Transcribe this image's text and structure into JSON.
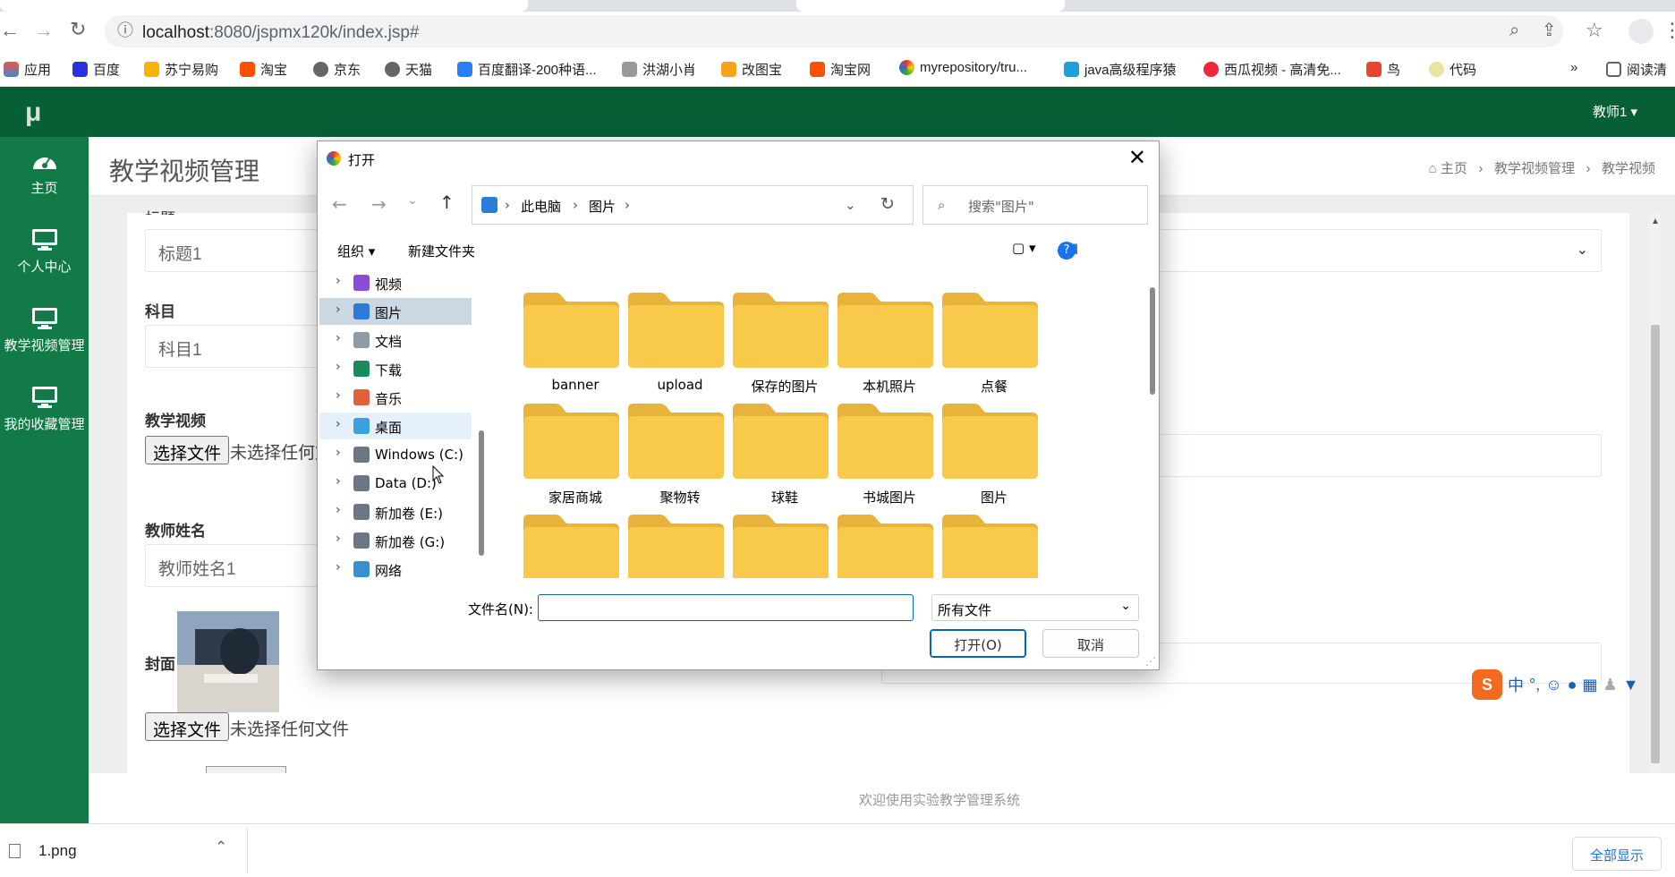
{
  "browser": {
    "url_host": "localhost",
    "url_rest": ":8080/jspmx120k/index.jsp#",
    "bookmarks": [
      "应用",
      "百度",
      "苏宁易购",
      "淘宝",
      "京东",
      "天猫",
      "百度翻译-200种语...",
      "洪湖小肖",
      "改图宝",
      "淘宝网",
      "myrepository/tru...",
      "java高级程序猿",
      "西瓜视频 - 高清免...",
      "鸟",
      "代码"
    ],
    "bookmarks_more": "»",
    "reading_list": "阅读清"
  },
  "app": {
    "logo": "μ",
    "user_menu": "教师1 ▾",
    "sidebar": [
      {
        "label": "主页",
        "icon": "dashboard-icon"
      },
      {
        "label": "个人中心",
        "icon": "monitor-icon"
      },
      {
        "label": "教学视频管理",
        "icon": "monitor-icon"
      },
      {
        "label": "我的收藏管理",
        "icon": "monitor-icon"
      }
    ],
    "page_title": "教学视频管理",
    "breadcrumb": {
      "home": "主页",
      "sep": "›",
      "level1": "教学视频管理",
      "level2": "教学视频"
    },
    "form": {
      "title_partial": "标题",
      "title_value": "标题1",
      "subject_label": "科目",
      "subject_value": "科目1",
      "video_label": "教学视频",
      "choose_file": "选择文件",
      "no_file": "未选择任何文件",
      "no_file_partial": "未选择任何文",
      "teacher_label": "教师姓名",
      "teacher_value": "教师姓名1",
      "cover_label": "封面"
    },
    "footer": "欢迎使用实验教学管理系统"
  },
  "dialog": {
    "title": "打开",
    "close": "✕",
    "path": [
      "此电脑",
      "图片"
    ],
    "search_placeholder": "搜索\"图片\"",
    "organize": "组织 ▾",
    "new_folder": "新建文件夹",
    "tree": [
      {
        "label": "视频",
        "color": "#8a4bd6"
      },
      {
        "label": "图片",
        "color": "#2b7bd8",
        "selected": true
      },
      {
        "label": "文档",
        "color": "#8d9aa8"
      },
      {
        "label": "下载",
        "color": "#1a8a5a"
      },
      {
        "label": "音乐",
        "color": "#e0623a"
      },
      {
        "label": "桌面",
        "color": "#3aa0e0",
        "hover": true
      },
      {
        "label": "Windows (C:)",
        "color": "#6b7785"
      },
      {
        "label": "Data (D:)",
        "color": "#6b7785"
      },
      {
        "label": "新加卷 (E:)",
        "color": "#6b7785"
      },
      {
        "label": "新加卷 (G:)",
        "color": "#6b7785"
      },
      {
        "label": "网络",
        "color": "#3a8fd0"
      }
    ],
    "folders": [
      "banner",
      "upload",
      "保存的图片",
      "本机照片",
      "点餐",
      "家居商城",
      "聚物转",
      "球鞋",
      "书城图片",
      "图片"
    ],
    "filename_label": "文件名(N):",
    "filename_value": "",
    "filter": "所有文件",
    "open_button": "打开(O)",
    "cancel_button": "取消"
  },
  "downloads": {
    "file": "1.png",
    "show_all": "全部显示"
  },
  "ime": {
    "mode": "中",
    "punct": "°,"
  },
  "colors": {
    "topbar": "#075f36",
    "sidebar": "#127a46",
    "folder": "#f8c94a"
  }
}
